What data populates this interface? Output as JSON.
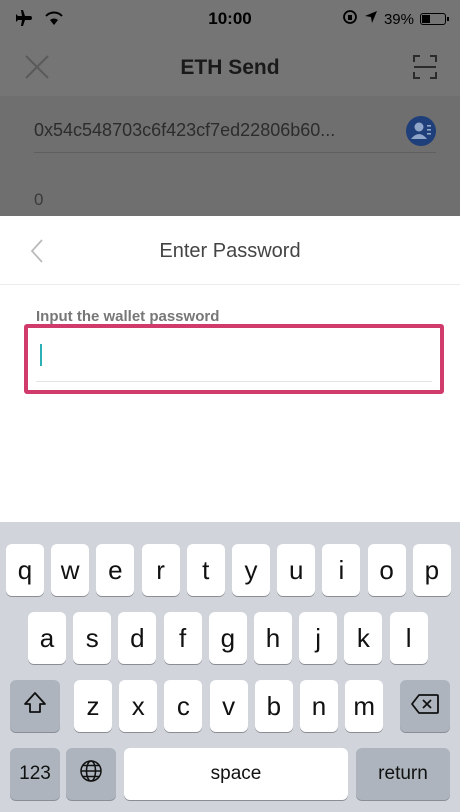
{
  "status_bar": {
    "time": "10:00",
    "battery": "39%",
    "battery_fraction": 0.39
  },
  "nav": {
    "title": "ETH Send",
    "close_icon": "close-icon",
    "scan_icon": "scan-icon"
  },
  "form": {
    "address": "0x54c548703c6f423cf7ed22806b60...",
    "amount": "0"
  },
  "password_sheet": {
    "title": "Enter Password",
    "label": "Input the wallet password",
    "value": ""
  },
  "keyboard": {
    "row1": [
      "q",
      "w",
      "e",
      "r",
      "t",
      "y",
      "u",
      "i",
      "o",
      "p"
    ],
    "row2": [
      "a",
      "s",
      "d",
      "f",
      "g",
      "h",
      "j",
      "k",
      "l"
    ],
    "row3": [
      "z",
      "x",
      "c",
      "v",
      "b",
      "n",
      "m"
    ],
    "numbers": "123",
    "space": "space",
    "return": "return"
  },
  "colors": {
    "highlight": "#d13b6c",
    "caret": "#2bb0b6",
    "contact_badge": "#1f3f7a"
  }
}
